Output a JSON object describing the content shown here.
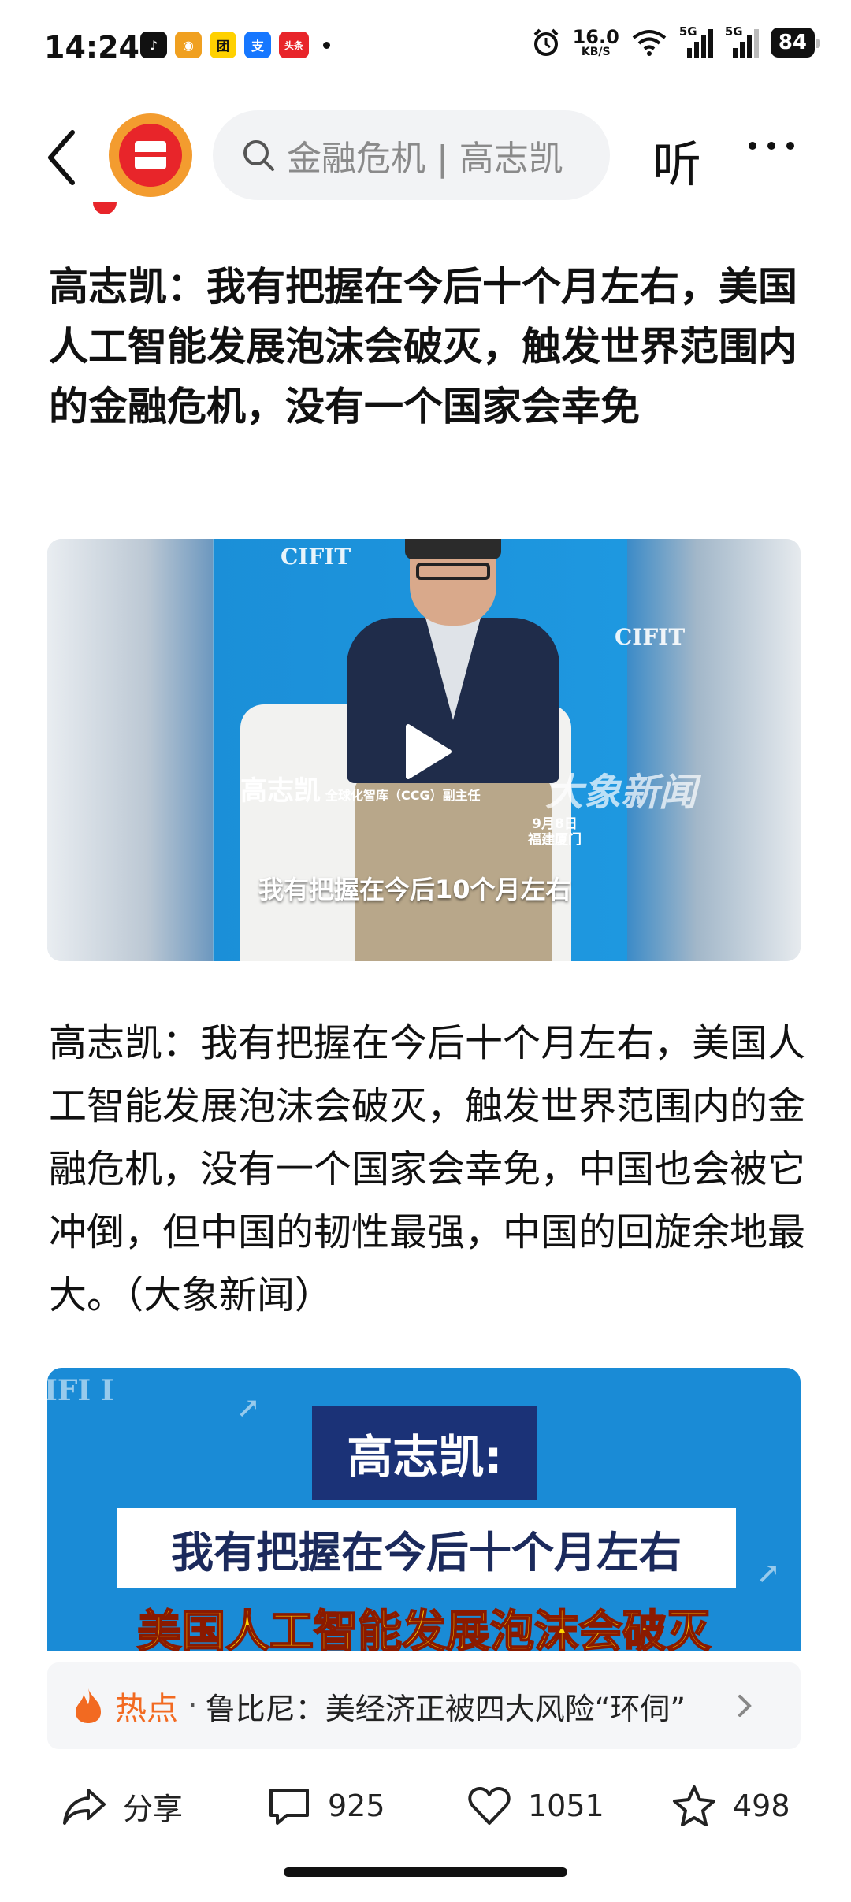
{
  "status_bar": {
    "time": "14:24",
    "app_badges": [
      {
        "name": "douyin",
        "color": "#111111",
        "glyph": "♪"
      },
      {
        "name": "weibo",
        "color": "#f0a020",
        "glyph": "◉"
      },
      {
        "name": "meituan",
        "color": "#ffd100",
        "glyph": "团"
      },
      {
        "name": "alipay",
        "color": "#1677ff",
        "glyph": "支"
      },
      {
        "name": "toutiao",
        "color": "#e8252a",
        "glyph": "头条"
      }
    ],
    "net_speed_value": "16.0",
    "net_speed_unit": "KB/S",
    "signal_1": "5G",
    "signal_2": "5G",
    "battery": "84"
  },
  "top_nav": {
    "search_placeholder": "金融危机 | 高志凯",
    "listen_label": "听"
  },
  "article": {
    "title": "高志凯：我有把握在今后十个月左右，美国人工智能发展泡沫会破灭，触发世界范围内的金融危机，没有一个国家会幸免",
    "video1": {
      "brand": "CIFIT",
      "speaker_name": "高志凯",
      "speaker_title": "全球化智库（CCG）副主任",
      "watermark": "大象新闻",
      "date": "9月8日",
      "location": "福建厦门",
      "subtitle": "我有把握在今后10个月左右"
    },
    "body": "高志凯：我有把握在今后十个月左右，美国人工智能发展泡沫会破灭，触发世界范围内的金融危机，没有一个国家会幸免，中国也会被它冲倒，但中国的韧性最强，中国的回旋余地最大。（大象新闻）",
    "video2": {
      "name_card": "高志凯:",
      "line1": "我有把握在今后十个月左右",
      "line2": "美国人工智能发展泡沫会破灭"
    }
  },
  "hot_bar": {
    "label": "热点",
    "separator": "·",
    "text": "鲁比尼：美经济正被四大风险“环伺”"
  },
  "actions": {
    "share_label": "分享",
    "comments": "925",
    "likes": "1051",
    "favorites": "498"
  },
  "colors": {
    "accent_orange": "#f26a21",
    "logo_red": "#e8252a",
    "video_blue": "#1a8bd6"
  }
}
